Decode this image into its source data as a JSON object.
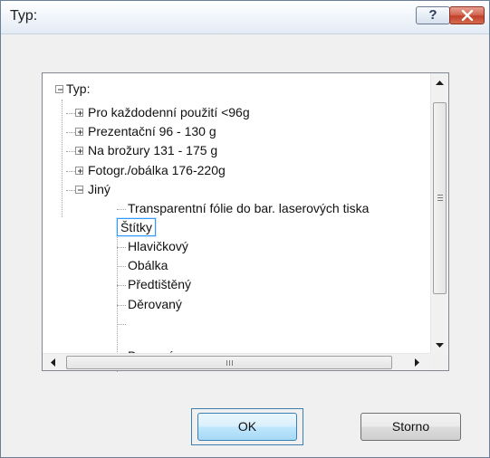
{
  "window": {
    "title": "Typ:",
    "help_label": "?"
  },
  "tree": {
    "root": "Typ:",
    "nodes": [
      {
        "label": "Pro každodenní použití <96g",
        "state": "collapsed"
      },
      {
        "label": "Prezentační 96 - 130 g",
        "state": "collapsed"
      },
      {
        "label": "Na brožury 131 - 175 g",
        "state": "collapsed"
      },
      {
        "label": "Fotogr./obálka 176-220g",
        "state": "collapsed"
      },
      {
        "label": "Jiný",
        "state": "expanded"
      }
    ],
    "children": [
      "Transparentní fólie do bar. laserových tiska",
      "Štítky",
      "Hlavičkový",
      "Obálka",
      "Předtištěný",
      "Děrovaný",
      "Barevný"
    ],
    "selected": "Štítky"
  },
  "buttons": {
    "ok": "OK",
    "cancel": "Storno"
  },
  "colors": {
    "selection_border": "#3399ff",
    "default_button_border": "#3c7fb1"
  }
}
